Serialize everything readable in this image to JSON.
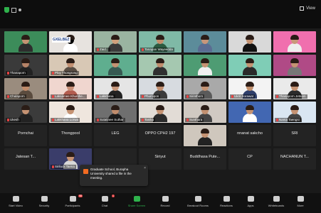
{
  "window": {
    "view_label": "View"
  },
  "tiles": [
    {
      "name": "",
      "bg": "#3c8c5a",
      "skin": "#c59373",
      "shirt": "#2d2d2d"
    },
    {
      "name": "",
      "bg": "#e7e3df",
      "skin": "#000000",
      "shirt": "#ffffff",
      "logo": "GXELBEZ"
    },
    {
      "name": "Zaid...",
      "bg": "#9ab4a1",
      "skin": "#d0a07c",
      "shirt": "#3a3a3a"
    },
    {
      "name": "Tanapan Wayeedda",
      "bg": "#7fb9a6",
      "skin": "#c28d6c",
      "shirt": "#2b5a40"
    },
    {
      "name": "",
      "bg": "#5c8c9a",
      "skin": "#c8967a",
      "shirt": "#5a6c92"
    },
    {
      "name": "",
      "bg": "#d9d9d9",
      "skin": "#c59373",
      "shirt": "#111111"
    },
    {
      "name": "",
      "bg": "#f06fae",
      "skin": "#c9987a",
      "shirt": "#eeeeee"
    },
    {
      "name": "Thanaporn",
      "bg": "#3a3a3a",
      "skin": "#b78367",
      "shirt": "#222222"
    },
    {
      "name": "Ploy Thongrong",
      "bg": "#d8c8b5",
      "skin": "#c29072",
      "shirt": "#5a4e44"
    },
    {
      "name": "",
      "bg": "#5fae8f",
      "skin": "#c49272",
      "shirt": "#375a52"
    },
    {
      "name": "",
      "bg": "#a5c8b0",
      "skin": "#c08d6d",
      "shirt": "#303030"
    },
    {
      "name": "",
      "bg": "#4e9c73",
      "skin": "#c59373",
      "shirt": "#f0f0f0"
    },
    {
      "name": "",
      "bg": "#7fcdb6",
      "skin": "#c49473",
      "shirt": "#2a2a2a"
    },
    {
      "name": "",
      "bg": "#b04a86",
      "skin": "#c59373",
      "shirt": "#777777"
    },
    {
      "name": "Chulaporn",
      "bg": "#9a8c7e",
      "skin": "#c08b6b",
      "shirt": "#5a4b3e"
    },
    {
      "name": "Laksamee Khunthe...",
      "bg": "#f0d6cf",
      "skin": "#c98f77",
      "shirt": "#b35c4f"
    },
    {
      "name": "Lakkhana",
      "bg": "#e5e5e5",
      "skin": "#c8977a",
      "shirt": "#222222"
    },
    {
      "name": "Phumipon",
      "bg": "#d7dbe0",
      "skin": "#c28e6e",
      "shirt": "#3b3b3b"
    },
    {
      "name": "Sirinthorn",
      "bg": "#a9a9a9",
      "skin": "#c59373",
      "shirt": "#5a5a5a"
    },
    {
      "name": "Ukrit Sorawat",
      "bg": "#f3f3f3",
      "skin": "#c08f6d",
      "shirt": "#2f3f6a"
    },
    {
      "name": "Thanaporn Jetsam",
      "bg": "#eaeaea",
      "skin": "#c59373",
      "shirt": "#2b2b2b"
    },
    {
      "name": "Ukesh",
      "bg": "#3b3b3b",
      "skin": "#c59373",
      "shirt": "#222222",
      "nameonly": "Udomsak..."
    },
    {
      "name": "Lakkhana Lorwa",
      "bg": "#efe6de",
      "skin": "#c59373",
      "shirt": "#ffffff"
    },
    {
      "name": "Sutatinee Suthar",
      "bg": "#6f6f6f",
      "skin": "#c08c6c",
      "shirt": "#1c1c1c"
    },
    {
      "name": "Tanika",
      "bg": "#e2dcd6",
      "skin": "#c59373",
      "shirt": "#2b2b2b"
    },
    {
      "name": "Sunthara",
      "bg": "#d0c9c2",
      "skin": "#c29070",
      "shirt": "#444444"
    },
    {
      "name": "",
      "bg": "#4267b2",
      "skin": "#c59373",
      "shirt": "#ffffff"
    },
    {
      "name": "Nanta Taengsi",
      "bg": "#d9e6f2",
      "skin": "#c59373",
      "shirt": "#444444"
    },
    {
      "name": "",
      "bg": "#232323",
      "nameonly": "Pornchai"
    },
    {
      "name": "",
      "bg": "#232323",
      "nameonly": "Thongpool"
    },
    {
      "name": "",
      "bg": "#232323",
      "nameonly": "LEG"
    },
    {
      "name": "",
      "bg": "#232323",
      "nameonly": "OPPO CPH2 197"
    },
    {
      "name": "",
      "bg": "#cfc7bd",
      "skin": "#c59373",
      "shirt": "#222222"
    },
    {
      "name": "",
      "bg": "#232323",
      "nameonly": "nnanat sakcho"
    },
    {
      "name": "",
      "bg": "#232323",
      "nameonly": "SRI"
    },
    {
      "name": "",
      "bg": "#232323",
      "nameonly": "Jatesan T..."
    },
    {
      "name": "Siriluck Taena",
      "bg": "#3a3d6a",
      "skin": "#c59373",
      "shirt": "#d8d8d8"
    },
    {
      "name": "",
      "bg": "#232323",
      "nameonly": ""
    },
    {
      "name": "",
      "bg": "#232323",
      "nameonly": "Siriyut"
    },
    {
      "name": "",
      "bg": "#232323",
      "nameonly": "Buddhasa Pute..."
    },
    {
      "name": "",
      "bg": "#232323",
      "nameonly": "CP"
    },
    {
      "name": "",
      "bg": "#232323",
      "nameonly": "NACHANUN T..."
    }
  ],
  "toast": {
    "message": "Graduate School, Burapha University shared a file in the meeting."
  },
  "toolbar": {
    "items": [
      {
        "label": "Start Video"
      },
      {
        "label": "Security"
      },
      {
        "label": "Participants",
        "badge": "98"
      },
      {
        "label": "Chat",
        "badge": "1"
      },
      {
        "label": "Share Screen",
        "green": true
      },
      {
        "label": "Record"
      },
      {
        "label": "Breakout Rooms"
      },
      {
        "label": "Reactions"
      },
      {
        "label": "Apps"
      },
      {
        "label": "Whiteboards"
      },
      {
        "label": "More"
      }
    ]
  }
}
